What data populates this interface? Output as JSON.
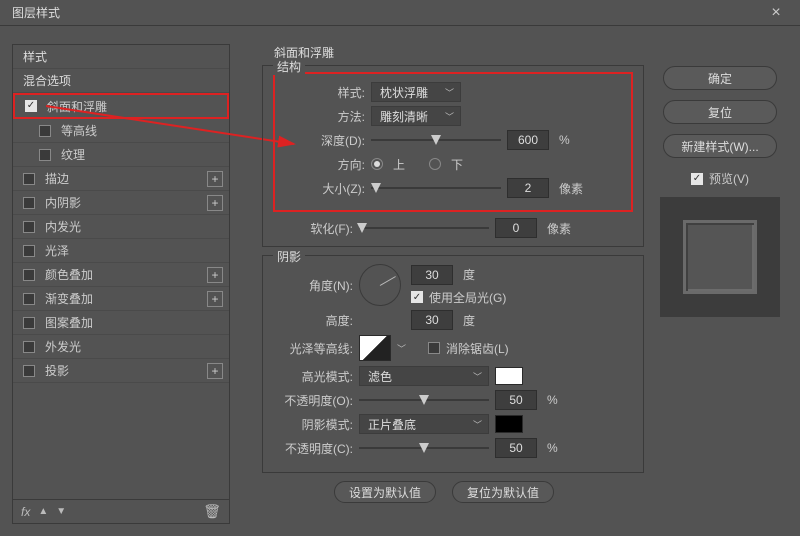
{
  "window": {
    "title": "图层样式"
  },
  "sidebar": {
    "styles_label": "样式",
    "blend_label": "混合选项",
    "items": [
      {
        "label": "斜面和浮雕",
        "checked": true,
        "selected": true,
        "plus": false,
        "indent": 0
      },
      {
        "label": "等高线",
        "checked": false,
        "selected": false,
        "plus": false,
        "indent": 1
      },
      {
        "label": "纹理",
        "checked": false,
        "selected": false,
        "plus": false,
        "indent": 1
      },
      {
        "label": "描边",
        "checked": false,
        "selected": false,
        "plus": true,
        "indent": 0
      },
      {
        "label": "内阴影",
        "checked": false,
        "selected": false,
        "plus": true,
        "indent": 0
      },
      {
        "label": "内发光",
        "checked": false,
        "selected": false,
        "plus": false,
        "indent": 0
      },
      {
        "label": "光泽",
        "checked": false,
        "selected": false,
        "plus": false,
        "indent": 0
      },
      {
        "label": "颜色叠加",
        "checked": false,
        "selected": false,
        "plus": true,
        "indent": 0
      },
      {
        "label": "渐变叠加",
        "checked": false,
        "selected": false,
        "plus": true,
        "indent": 0
      },
      {
        "label": "图案叠加",
        "checked": false,
        "selected": false,
        "plus": false,
        "indent": 0
      },
      {
        "label": "外发光",
        "checked": false,
        "selected": false,
        "plus": false,
        "indent": 0
      },
      {
        "label": "投影",
        "checked": false,
        "selected": false,
        "plus": true,
        "indent": 0
      }
    ],
    "fx_label": "fx"
  },
  "panel": {
    "section_title": "斜面和浮雕",
    "structure": {
      "title": "结构",
      "style_label": "样式:",
      "style_value": "枕状浮雕",
      "technique_label": "方法:",
      "technique_value": "雕刻清晰",
      "depth_label": "深度(D):",
      "depth_value": "600",
      "depth_unit": "%",
      "direction_label": "方向:",
      "dir_up": "上",
      "dir_down": "下",
      "size_label": "大小(Z):",
      "size_value": "2",
      "size_unit": "像素",
      "soften_label": "软化(F):",
      "soften_value": "0",
      "soften_unit": "像素"
    },
    "shading": {
      "title": "阴影",
      "angle_label": "角度(N):",
      "angle_value": "30",
      "angle_unit": "度",
      "use_global": "使用全局光(G)",
      "alt_label": "高度:",
      "alt_value": "30",
      "alt_unit": "度",
      "gloss_label": "光泽等高线:",
      "antialias_label": "消除锯齿(L)",
      "hi_mode_label": "高光模式:",
      "hi_mode_value": "滤色",
      "hi_color": "#ffffff",
      "hi_op_label": "不透明度(O):",
      "hi_op_value": "50",
      "hi_op_unit": "%",
      "sh_mode_label": "阴影模式:",
      "sh_mode_value": "正片叠底",
      "sh_color": "#000000",
      "sh_op_label": "不透明度(C):",
      "sh_op_value": "50",
      "sh_op_unit": "%"
    },
    "buttons": {
      "make_default": "设置为默认值",
      "reset_default": "复位为默认值"
    }
  },
  "right": {
    "ok": "确定",
    "reset": "复位",
    "newstyle": "新建样式(W)...",
    "preview": "预览(V)"
  }
}
